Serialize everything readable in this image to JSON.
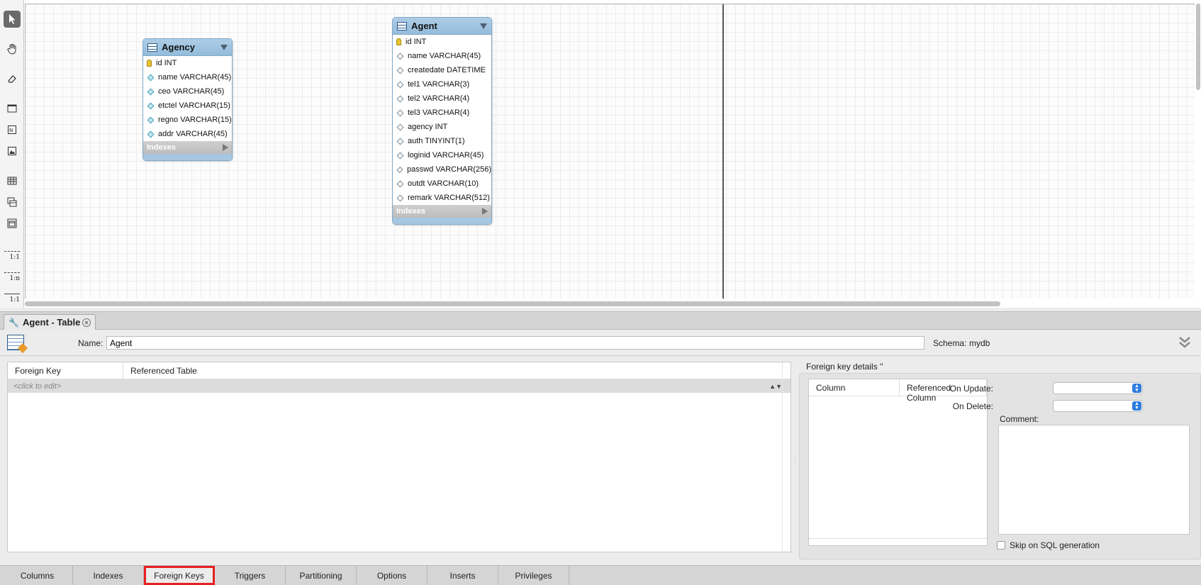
{
  "toolbar": {
    "tools": [
      "pointer-icon",
      "hand-icon",
      "eraser-icon",
      "layer-icon",
      "note-icon",
      "image-icon",
      "table-icon",
      "view-icon",
      "routine-group-icon"
    ],
    "relationships": [
      "1:1",
      "1:n",
      "1:1"
    ]
  },
  "diagram": {
    "tables": [
      {
        "name": "Agency",
        "columns": [
          {
            "text": "id INT",
            "kind": "pk"
          },
          {
            "text": "name VARCHAR(45)",
            "kind": "filled"
          },
          {
            "text": "ceo VARCHAR(45)",
            "kind": "filled"
          },
          {
            "text": "etctel VARCHAR(15)",
            "kind": "filled"
          },
          {
            "text": "regno VARCHAR(15)",
            "kind": "filled"
          },
          {
            "text": "addr VARCHAR(45)",
            "kind": "filled"
          }
        ],
        "indexes_label": "Indexes"
      },
      {
        "name": "Agent",
        "columns": [
          {
            "text": "id INT",
            "kind": "pk"
          },
          {
            "text": "name VARCHAR(45)",
            "kind": "empty"
          },
          {
            "text": "createdate DATETIME",
            "kind": "empty"
          },
          {
            "text": "tel1 VARCHAR(3)",
            "kind": "empty"
          },
          {
            "text": "tel2 VARCHAR(4)",
            "kind": "empty"
          },
          {
            "text": "tel3 VARCHAR(4)",
            "kind": "empty"
          },
          {
            "text": "agency INT",
            "kind": "empty"
          },
          {
            "text": "auth TINYINT(1)",
            "kind": "empty"
          },
          {
            "text": "loginid VARCHAR(45)",
            "kind": "empty"
          },
          {
            "text": "passwd VARCHAR(256)",
            "kind": "empty"
          },
          {
            "text": "outdt VARCHAR(10)",
            "kind": "empty"
          },
          {
            "text": "remark VARCHAR(512)",
            "kind": "empty"
          }
        ],
        "indexes_label": "Indexes"
      }
    ]
  },
  "editor": {
    "tab_title": "Agent - Table",
    "name_label": "Name:",
    "name_value": "Agent",
    "schema_label": "Schema:",
    "schema_value": "mydb"
  },
  "foreign_keys": {
    "headers": [
      "Foreign Key",
      "Referenced Table"
    ],
    "placeholder_row": "<click to edit>",
    "details_title": "Foreign key details ''",
    "details_headers": [
      "Column",
      "Referenced Column"
    ],
    "on_update_label": "On Update:",
    "on_delete_label": "On Delete:",
    "comment_label": "Comment:",
    "skip_label": "Skip on SQL generation"
  },
  "bottom_tabs": {
    "items": [
      "Columns",
      "Indexes",
      "Foreign Keys",
      "Triggers",
      "Partitioning",
      "Options",
      "Inserts",
      "Privileges"
    ],
    "active": "Foreign Keys"
  },
  "colors": {
    "highlight": "#e81f1f",
    "table_header": "#94bcdb",
    "select_accent": "#2d7de0"
  }
}
